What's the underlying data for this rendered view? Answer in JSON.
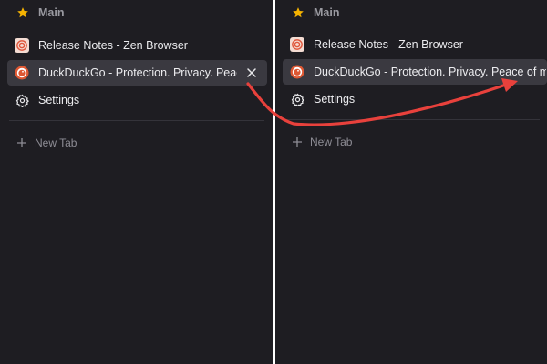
{
  "left_panel": {
    "workspace": {
      "label": "Main",
      "icon": "star-icon"
    },
    "tabs": [
      {
        "label": "Release Notes - Zen Browser",
        "icon": "zen-browser-favicon",
        "active": false
      },
      {
        "label": "DuckDuckGo - Protection. Privacy. Peace",
        "icon": "duckduckgo-favicon",
        "active": true
      },
      {
        "label": "Settings",
        "icon": "gear-icon",
        "active": false
      }
    ],
    "new_tab_label": "New Tab"
  },
  "right_panel": {
    "workspace": {
      "label": "Main",
      "icon": "star-icon"
    },
    "tabs": [
      {
        "label": "Release Notes - Zen Browser",
        "icon": "zen-browser-favicon",
        "active": false
      },
      {
        "label": "DuckDuckGo - Protection. Privacy. Peace of m",
        "icon": "duckduckgo-favicon",
        "active": true
      },
      {
        "label": "Settings",
        "icon": "gear-icon",
        "active": false
      }
    ],
    "new_tab_label": "New Tab"
  },
  "colors": {
    "sidebar_bg": "#1e1d22",
    "active_tab_bg": "#3a3940",
    "star": "#f5b301",
    "annotation_arrow": "#e8413c"
  }
}
